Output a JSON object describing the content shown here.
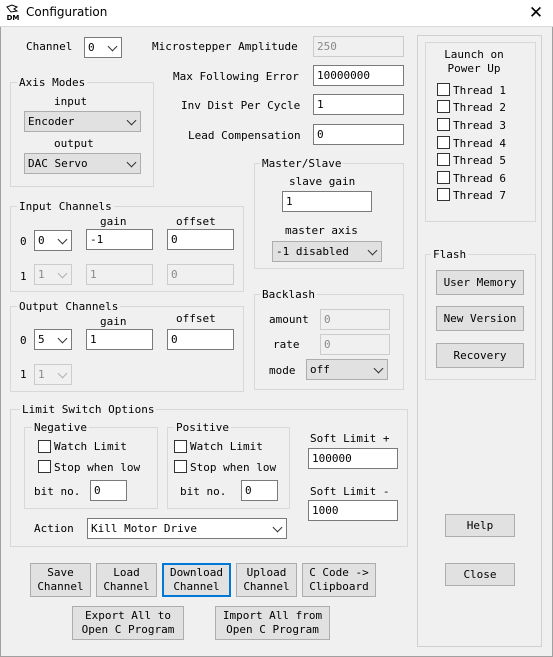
{
  "window": {
    "title": "Configuration",
    "icon_text": "DM"
  },
  "channel": {
    "label": "Channel",
    "value": "0"
  },
  "microstepper": {
    "label": "Microstepper Amplitude",
    "value": "250"
  },
  "following_error": {
    "label": "Max Following Error",
    "value": "10000000"
  },
  "inv_dist": {
    "label": "Inv Dist Per Cycle",
    "value": "1"
  },
  "lead_comp": {
    "label": "Lead Compensation",
    "value": "0"
  },
  "axis_modes": {
    "title": "Axis Modes",
    "input_label": "input",
    "input_value": "Encoder",
    "output_label": "output",
    "output_value": "DAC Servo"
  },
  "input_channels": {
    "title": "Input Channels",
    "gain_label": "gain",
    "offset_label": "offset",
    "rows": [
      {
        "index": "0",
        "channel": "0",
        "gain": "-1",
        "offset": "0"
      },
      {
        "index": "1",
        "channel": "1",
        "gain": "1",
        "offset": "0"
      }
    ]
  },
  "output_channels": {
    "title": "Output Channels",
    "gain_label": "gain",
    "offset_label": "offset",
    "rows": [
      {
        "index": "0",
        "channel": "5",
        "gain": "1",
        "offset": "0"
      },
      {
        "index": "1",
        "channel": "1"
      }
    ]
  },
  "master_slave": {
    "title": "Master/Slave",
    "slave_gain_label": "slave gain",
    "slave_gain": "1",
    "master_axis_label": "master axis",
    "master_axis": "-1 disabled"
  },
  "backlash": {
    "title": "Backlash",
    "amount_label": "amount",
    "amount": "0",
    "rate_label": "rate",
    "rate": "0",
    "mode_label": "mode",
    "mode": "off"
  },
  "limit_switch": {
    "title": "Limit Switch Options",
    "negative": {
      "title": "Negative",
      "watch": "Watch Limit",
      "stop": "Stop when low",
      "bit_label": "bit no.",
      "bit": "0"
    },
    "positive": {
      "title": "Positive",
      "watch": "Watch Limit",
      "stop": "Stop when low",
      "bit_label": "bit no.",
      "bit": "0"
    },
    "soft_plus_label": "Soft Limit +",
    "soft_plus": "100000",
    "soft_minus_label": "Soft Limit -",
    "soft_minus": "1000",
    "action_label": "Action",
    "action": "Kill Motor Drive"
  },
  "launch": {
    "title_line1": "Launch on",
    "title_line2": "Power Up",
    "threads": [
      "Thread 1",
      "Thread 2",
      "Thread 3",
      "Thread 4",
      "Thread 5",
      "Thread 6",
      "Thread 7"
    ]
  },
  "flash": {
    "title": "Flash",
    "user_memory": "User Memory",
    "new_version": "New Version",
    "recovery": "Recovery"
  },
  "buttons": {
    "help": "Help",
    "close": "Close",
    "save_channel": "Save\nChannel",
    "load_channel": "Load\nChannel",
    "download_channel": "Download\nChannel",
    "upload_channel": "Upload\nChannel",
    "c_code": "C Code ->\nClipboard",
    "export_all": "Export All to\nOpen C Program",
    "import_all": "Import All from\nOpen C Program"
  }
}
